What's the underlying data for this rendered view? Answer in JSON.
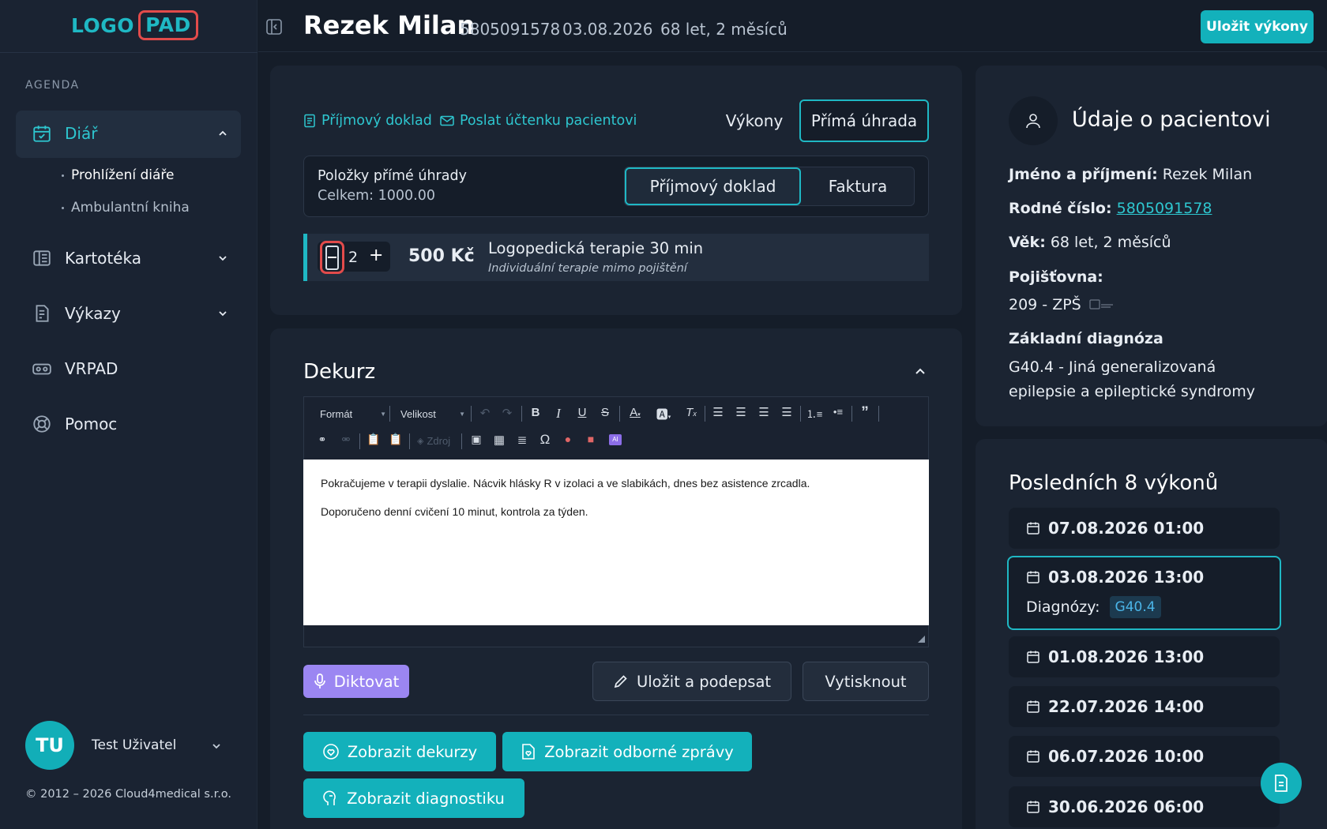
{
  "app": {
    "logo_left": "LOGO",
    "logo_right": "PAD"
  },
  "sidebar": {
    "section": "AGENDA",
    "items": [
      {
        "label": "Diář",
        "icon": "calendar-check-icon"
      },
      {
        "label": "Kartotéka",
        "icon": "cards-icon"
      },
      {
        "label": "Výkazy",
        "icon": "report-icon"
      },
      {
        "label": "VRPAD",
        "icon": "vr-headset-icon"
      },
      {
        "label": "Pomoc",
        "icon": "lifebuoy-icon"
      }
    ],
    "subitems": [
      {
        "label": "Prohlížení diáře"
      },
      {
        "label": "Ambulantní kniha"
      }
    ],
    "user": {
      "initials": "TU",
      "name": "Test Uživatel"
    },
    "copyright": "© 2012 – 2026 Cloud4medical s.r.o."
  },
  "header": {
    "patient_name": "Rezek Milan",
    "birth_number": "5805091578",
    "date": "03.08.2026",
    "age": "68 let, 2 měsíců",
    "save_label": "Uložit výkony"
  },
  "payment": {
    "link_receipt": "Příjmový doklad",
    "link_send": "Poslat účtenku pacientovi",
    "tab_services": "Výkony",
    "tab_direct": "Přímá úhrada",
    "items_title": "Položky přímé úhrady",
    "items_total": "Celkem: 1000.00",
    "doc_receipt": "Příjmový doklad",
    "doc_invoice": "Faktura",
    "item": {
      "quantity": "2",
      "price": "500 Kč",
      "name": "Logopedická terapie 30 min",
      "description": "Individuální terapie mimo pojištění"
    }
  },
  "dekurz": {
    "title": "Dekurz",
    "toolbar": {
      "format": "Formát",
      "size": "Velikost",
      "source": "Zdroj"
    },
    "text": [
      "Pokračujeme v terapii dyslalie. Nácvik hlásky R v izolaci a ve slabikách, dnes bez asistence zrcadla.",
      "Doporučeno denní cvičení 10 minut, kontrola za týden."
    ],
    "btn_dictate": "Diktovat",
    "btn_save_sign": "Uložit a podepsat",
    "btn_print": "Vytisknout",
    "btn_show_dekurz": "Zobrazit dekurzy",
    "btn_show_reports": "Zobrazit odborné zprávy",
    "btn_show_diag": "Zobrazit diagnostiku"
  },
  "patient": {
    "title": "Údaje o pacientovi",
    "name_label": "Jméno a příjmení:",
    "name": "Rezek Milan",
    "rc_label": "Rodné číslo:",
    "rc": "5805091578",
    "age_label": "Věk:",
    "age": "68 let, 2 měsíců",
    "insurer_label": "Pojišťovna:",
    "insurer": "209 - ZPŠ",
    "diag_label": "Základní diagnóza",
    "diag_line1": "G40.4 - Jiná generalizovaná",
    "diag_line2": "epilepsie a epileptické syndromy"
  },
  "visits": {
    "title": "Posledních 8 výkonů",
    "diag_label": "Diagnózy:",
    "items": [
      {
        "datetime": "07.08.2026 01:00"
      },
      {
        "datetime": "03.08.2026 13:00",
        "diagnosis": "G40.4"
      },
      {
        "datetime": "01.08.2026 13:00"
      },
      {
        "datetime": "22.07.2026 14:00"
      },
      {
        "datetime": "06.07.2026 10:00"
      },
      {
        "datetime": "30.06.2026 06:00"
      }
    ]
  },
  "colors": {
    "accent": "#13b1bb",
    "danger": "#e24b4b",
    "purple": "#9b86f2",
    "bg": "#151d29",
    "panel": "#1b2432"
  }
}
